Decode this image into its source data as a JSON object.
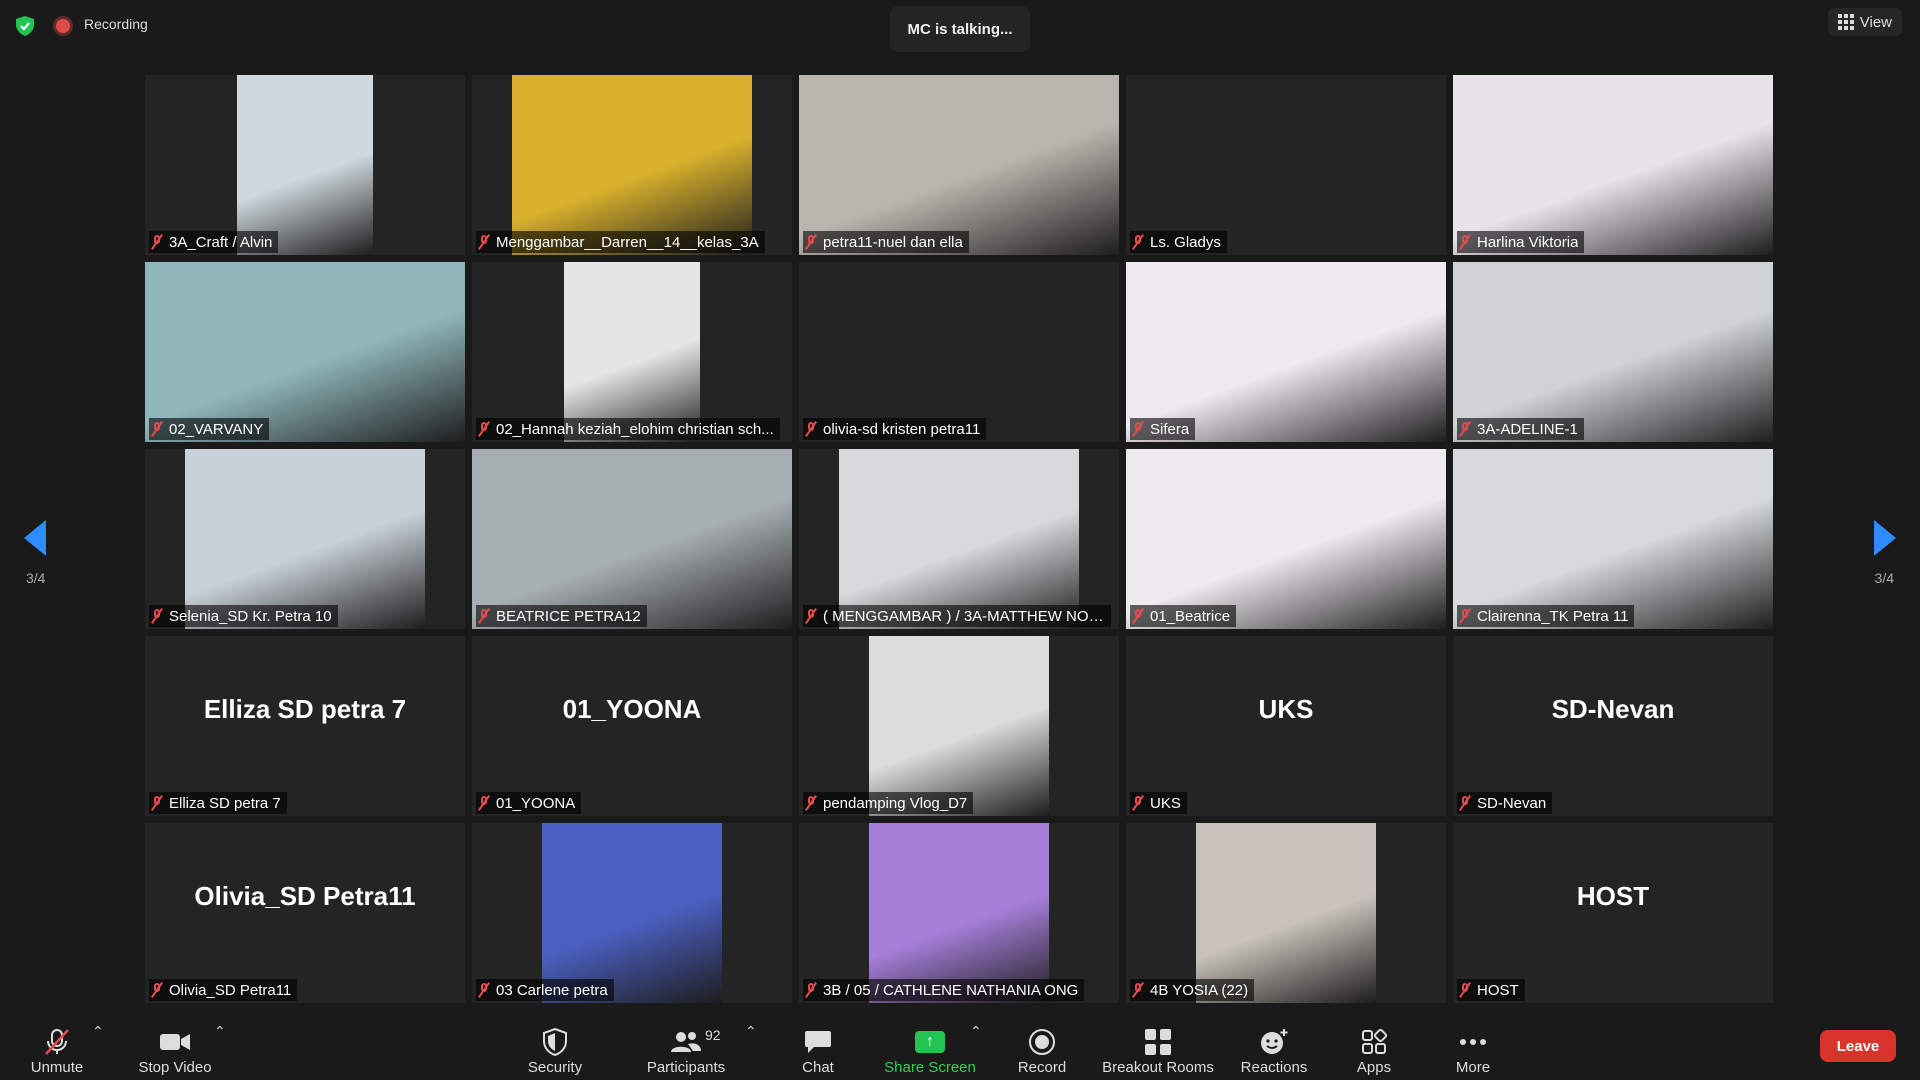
{
  "topbar": {
    "recording_label": "Recording",
    "talking": "MC is talking...",
    "view_label": "View"
  },
  "pager": {
    "left": "3/4",
    "right": "3/4"
  },
  "tiles": [
    {
      "name": "3A_Craft / Alvin",
      "video": true,
      "bg": "#cfd8de"
    },
    {
      "name": "Menggambar__Darren__14__kelas_3A",
      "video": true,
      "bg": "#d9b12c"
    },
    {
      "name": "petra11-nuel dan ella",
      "video": true,
      "bg": "#b9b4ad"
    },
    {
      "name": "Ls. Gladys",
      "video": false,
      "big": ""
    },
    {
      "name": "Harlina Viktoria",
      "video": true,
      "bg": "#e9e2ea"
    },
    {
      "name": "02_VARVANY",
      "video": true,
      "bg": "#8fb6bb"
    },
    {
      "name": "02_Hannah keziah_elohim christian sch...",
      "video": true,
      "bg": "#e5e5e5"
    },
    {
      "name": "olivia-sd kristen petra11",
      "video": false,
      "big": ""
    },
    {
      "name": "Sifera",
      "video": true,
      "bg": "#f1e9f1"
    },
    {
      "name": "3A-ADELINE-1",
      "video": true,
      "bg": "#cfd3d6"
    },
    {
      "name": "Selenia_SD Kr. Petra 10",
      "video": true,
      "bg": "#c9d1d8"
    },
    {
      "name": "BEATRICE PETRA12",
      "video": true,
      "bg": "#a8afb3"
    },
    {
      "name": "( MENGGAMBAR ) / 3A-MATTHEW NO ...",
      "video": true,
      "bg": "#d7d9db"
    },
    {
      "name": "01_Beatrice",
      "video": true,
      "bg": "#eeeaee"
    },
    {
      "name": "Clairenna_TK Petra 11",
      "video": true,
      "bg": "#d6dadc"
    },
    {
      "name": "Elliza SD petra 7",
      "video": false,
      "big": "Elliza SD petra 7"
    },
    {
      "name": "01_YOONA",
      "video": false,
      "big": "01_YOONA"
    },
    {
      "name": "pendamping Vlog_D7",
      "video": true,
      "bg": "#dcdcdc"
    },
    {
      "name": "UKS",
      "video": false,
      "big": "UKS"
    },
    {
      "name": "SD-Nevan",
      "video": false,
      "big": "SD-Nevan"
    },
    {
      "name": "Olivia_SD Petra11",
      "video": false,
      "big": "Olivia_SD Petra11"
    },
    {
      "name": "03 Carlene petra",
      "video": true,
      "bg": "#4a5fbf"
    },
    {
      "name": "3B / 05 / CATHLENE NATHANIA ONG",
      "video": true,
      "bg": "#a67fd9"
    },
    {
      "name": "4B YOSIA (22)",
      "video": true,
      "bg": "#c9c3bb"
    },
    {
      "name": "HOST",
      "video": false,
      "big": "HOST"
    }
  ],
  "toolbar": {
    "unmute": "Unmute",
    "stop_video": "Stop Video",
    "security": "Security",
    "participants": "Participants",
    "participant_count": "92",
    "chat": "Chat",
    "share_screen": "Share Screen",
    "record": "Record",
    "breakout": "Breakout Rooms",
    "reactions": "Reactions",
    "apps": "Apps",
    "more": "More",
    "leave": "Leave"
  },
  "colors": {
    "accent": "#2d8cff",
    "share": "#23c552",
    "leave": "#d9342b",
    "mute": "#e34c4c"
  }
}
